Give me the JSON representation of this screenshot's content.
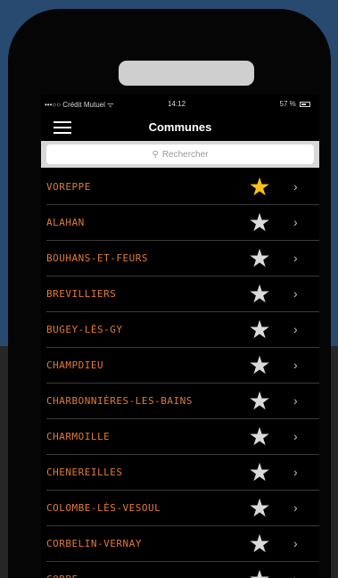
{
  "status_bar": {
    "carrier": "•••○○ Crédit Mutuel ᯤ",
    "time": "14:12",
    "battery": "57 %"
  },
  "header": {
    "title": "Communes",
    "menu_icon": "hamburger-menu-icon"
  },
  "search": {
    "placeholder": "Rechercher",
    "icon": "search-icon"
  },
  "communes": [
    {
      "name": "VOREPPE",
      "favorite": true
    },
    {
      "name": "ALAHAN",
      "favorite": false
    },
    {
      "name": "BOUHANS-ET-FEURS",
      "favorite": false
    },
    {
      "name": "BREVILLIERS",
      "favorite": false
    },
    {
      "name": "BUGEY-LÈS-GY",
      "favorite": false
    },
    {
      "name": "CHAMPDIEU",
      "favorite": false
    },
    {
      "name": "CHARBONNIÈRES-LES-BAINS",
      "favorite": false
    },
    {
      "name": "CHARMOILLE",
      "favorite": false
    },
    {
      "name": "CHENEREILLES",
      "favorite": false
    },
    {
      "name": "COLOMBE-LÈS-VESOUL",
      "favorite": false
    },
    {
      "name": "CORBELIN-VERNAY",
      "favorite": false
    },
    {
      "name": "CORBE",
      "favorite": false
    }
  ],
  "colors": {
    "favorite_star": "#f6c21c",
    "star": "#dadada",
    "label": "#e07a34",
    "background_top": "#284a70"
  }
}
